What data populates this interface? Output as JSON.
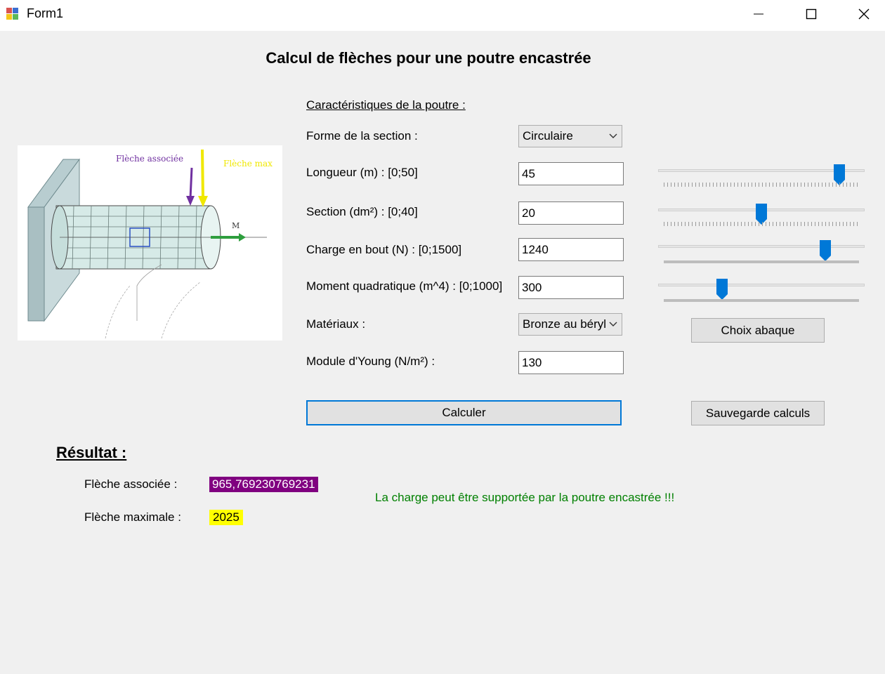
{
  "window": {
    "title": "Form1"
  },
  "header": {
    "title": "Calcul de flèches pour une poutre encastrée"
  },
  "diagram": {
    "label_associated": "Flèche associée",
    "label_max": "Flèche max",
    "label_moment": "M"
  },
  "characteristics": {
    "heading": "Caractéristiques de la poutre :",
    "section_shape_label": "Forme de la section :",
    "section_shape_value": "Circulaire",
    "length_label": "Longueur (m) : [0;50]",
    "length_value": "45",
    "section_label": "Section (dm²) : [0;40]",
    "section_value": "20",
    "load_label": "Charge en bout (N) : [0;1500]",
    "load_value": "1240",
    "moment_label": "Moment quadratique (m^4) : [0;1000]",
    "moment_value": "300",
    "material_label": "Matériaux :",
    "material_value": "Bronze au béryllium",
    "young_label": "Module d'Young (N/m²) :",
    "young_value": "130"
  },
  "sliders": {
    "length_fraction": 0.9,
    "section_fraction": 0.5,
    "load_fraction": 0.827,
    "moment_fraction": 0.3
  },
  "buttons": {
    "abaque": "Choix abaque",
    "calculate": "Calculer",
    "save": "Sauvegarde calculs"
  },
  "result": {
    "heading": "Résultat :",
    "associated_label": "Flèche associée :",
    "associated_value": "965,769230769231",
    "max_label": "Flèche maximale :",
    "max_value": "2025",
    "message": "La charge peut être supportée par la poutre encastrée !!!"
  },
  "colors": {
    "accent": "#0078d7",
    "associated_highlight": "#800080",
    "max_highlight": "#ffff00",
    "success_text": "#008000"
  }
}
